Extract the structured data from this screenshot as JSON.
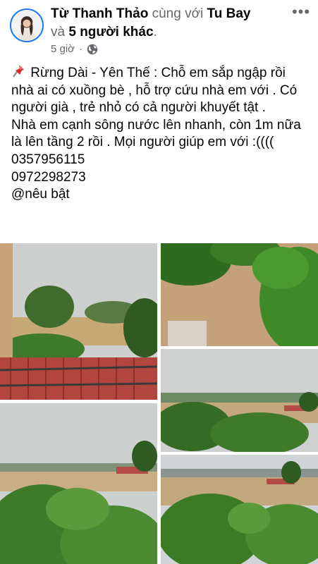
{
  "post": {
    "author": "Từ Thanh Thảo",
    "with_word": "cùng với",
    "tagged": "Tu Bay",
    "and_word": "và",
    "others": "5 người khác",
    "time": "5 giờ",
    "separator": "·",
    "privacy_icon": "globe-icon",
    "more_icon": "more-options-icon",
    "more_glyph": "•••",
    "lines": [
      "Rừng Dài - Yên Thế : Chỗ em sắp ngập rồi nhà ai có xuồng bè , hỗ trợ cứu nhà em với . Có người già , trẻ nhỏ có cả người khuyết tật .",
      "Nhà em cạnh sông nước lên nhanh, còn 1m nữa là lên tầng 2 rồi . Mọi người giúp em với :((((",
      "0357956115",
      "0972298273"
    ],
    "highlight_tag": "@nêu bật"
  },
  "photos": [
    {
      "name": "flood-photo-1",
      "desc": "balcony-rooftop-view"
    },
    {
      "name": "flood-photo-2",
      "desc": "muddy-water-trees"
    },
    {
      "name": "flood-photo-3",
      "desc": "flooded-fields"
    },
    {
      "name": "flood-photo-4",
      "desc": "trees-foreground"
    },
    {
      "name": "flood-photo-5",
      "desc": "village-flooded"
    }
  ],
  "colors": {
    "accent": "#1877f2",
    "secondary_text": "#65676b",
    "flood_water": "#c3a77d",
    "foliage": "#2f6b1e"
  }
}
